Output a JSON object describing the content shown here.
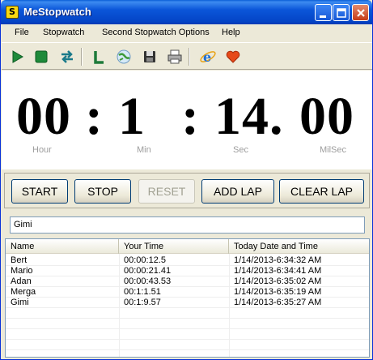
{
  "window": {
    "title": "MeStopwatch",
    "app_icon_letter": "S"
  },
  "menu": {
    "items": [
      "File",
      "Stopwatch",
      "Second Stopwatch Options",
      "Help"
    ]
  },
  "toolbar": {
    "icons": [
      "play-icon",
      "stop-icon",
      "swap-icon",
      "lap-icon",
      "world-icon",
      "save-icon",
      "print-icon",
      "internet-explorer-icon",
      "heart-icon"
    ],
    "lap_glyph": "L"
  },
  "display": {
    "hours": "00",
    "minutes": "1",
    "seconds": "14.",
    "milliseconds": "00",
    "sep1": ":",
    "sep2": ":",
    "unit_hour": "Hour",
    "unit_min": "Min",
    "unit_sec": "Sec",
    "unit_milsec": "MilSec"
  },
  "buttons": {
    "start": "START",
    "stop": "STOP",
    "reset": "RESET",
    "add_lap": "ADD LAP",
    "clear_lap": "CLEAR LAP"
  },
  "name_input": {
    "value": "Gimi"
  },
  "laps": {
    "columns": [
      "Name",
      "Your Time",
      "Today Date and Time"
    ],
    "rows": [
      {
        "name": "Bert",
        "time": "00:00:12.5",
        "datetime": "1/14/2013-6:34:32 AM"
      },
      {
        "name": "Mario",
        "time": "00:00:21.41",
        "datetime": "1/14/2013-6:34:41 AM"
      },
      {
        "name": "Adan",
        "time": "00:00:43.53",
        "datetime": "1/14/2013-6:35:02 AM"
      },
      {
        "name": "Merga",
        "time": "00:1:1.51",
        "datetime": "1/14/2013-6:35:19 AM"
      },
      {
        "name": "Gimi",
        "time": "00:1:9.57",
        "datetime": "1/14/2013-6:35:27 AM"
      }
    ]
  },
  "colors": {
    "titlebar": "#0b56d9",
    "unit_label": "#9d9d9d",
    "heart": "#e64a19",
    "play_green": "#1e8a3a"
  }
}
